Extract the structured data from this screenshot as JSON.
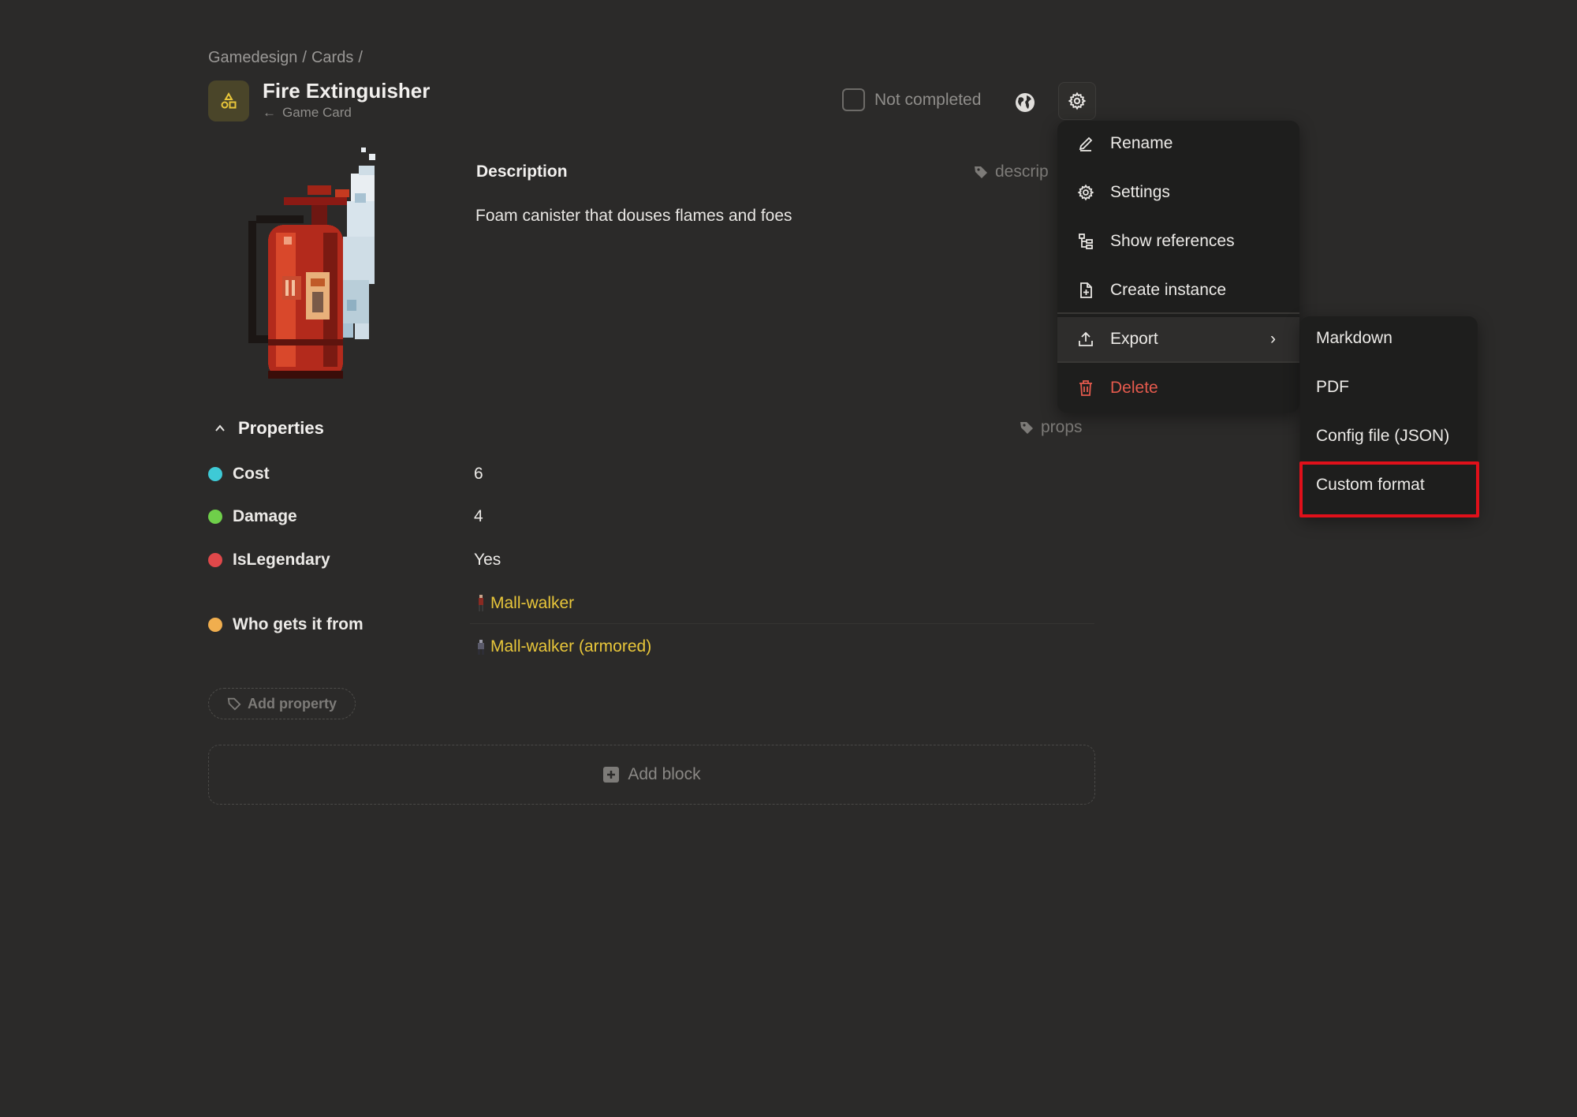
{
  "breadcrumb": {
    "items": [
      "Gamedesign",
      "Cards"
    ],
    "separator": "/"
  },
  "header": {
    "title": "Fire Extinguisher",
    "template": "Game Card",
    "template_arrow": "←",
    "page_icon": "shapes-icon",
    "status_label": "Not completed",
    "icons": [
      "globe-icon",
      "gear-icon"
    ]
  },
  "description": {
    "heading": "Description",
    "tag": "descrip",
    "text": "Foam canister that douses flames and foes"
  },
  "properties": {
    "heading": "Properties",
    "tag": "props",
    "items": [
      {
        "label": "Cost",
        "value": "6",
        "color": "#3ecad6"
      },
      {
        "label": "Damage",
        "value": "4",
        "color": "#6fcf4a"
      },
      {
        "label": "IsLegendary",
        "value": "Yes",
        "color": "#e0484a"
      },
      {
        "label": "Who gets it from",
        "color": "#f0ae4e",
        "refs": [
          "Mall-walker",
          "Mall-walker (armored)"
        ]
      }
    ],
    "add_property": "Add property"
  },
  "add_block": "Add block",
  "menu": {
    "items": [
      {
        "label": "Rename",
        "icon": "pencil-icon"
      },
      {
        "label": "Settings",
        "icon": "gear-icon"
      },
      {
        "label": "Show references",
        "icon": "tree-icon"
      },
      {
        "label": "Create instance",
        "icon": "file-plus-icon"
      },
      {
        "label": "Export",
        "icon": "upload-icon",
        "active": true,
        "chevron": "›"
      },
      {
        "label": "Delete",
        "icon": "trash-icon",
        "danger": true
      }
    ]
  },
  "submenu": {
    "items": [
      "Markdown",
      "PDF",
      "Config file (JSON)",
      "Custom format"
    ],
    "highlighted": "Custom format"
  },
  "colors": {
    "background": "#2b2a29",
    "menu_bg": "#1e1e1d",
    "accent_yellow": "#e8c63a",
    "danger": "#e55a4d",
    "highlight": "#e0101a"
  }
}
